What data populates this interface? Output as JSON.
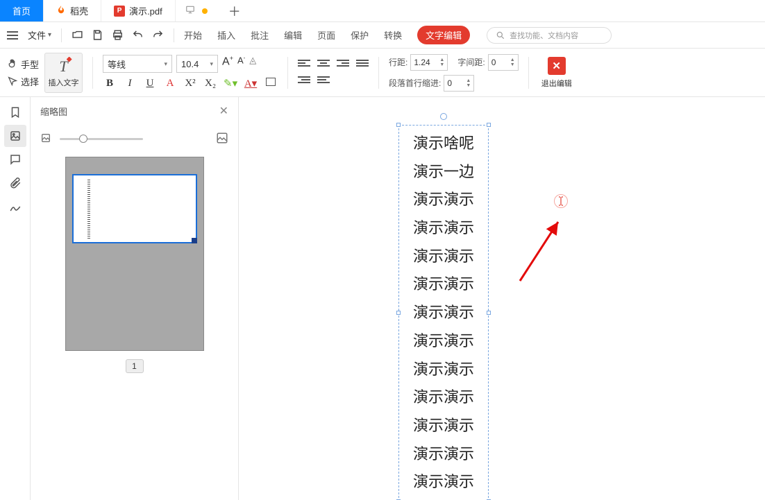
{
  "tabs": {
    "home": "首页",
    "daoshell": "稻壳",
    "doc": "演示.pdf"
  },
  "menubar": {
    "file_label": "文件",
    "start": "开始",
    "insert": "插入",
    "annotate": "批注",
    "edit": "编辑",
    "page": "页面",
    "protect": "保护",
    "convert": "转换",
    "text_edit": "文字编辑",
    "search_placeholder": "查找功能、文档内容"
  },
  "ribbon": {
    "hand": "手型",
    "select": "选择",
    "insert_text": "插入文字",
    "font_name": "等线",
    "font_size": "10.4",
    "line_spacing_label": "行距:",
    "line_spacing": "1.24",
    "char_spacing_label": "字间距:",
    "char_spacing": "0",
    "first_indent_label": "段落首行缩进:",
    "first_indent": "0",
    "exit_edit": "退出编辑"
  },
  "side_panel": {
    "title": "缩略图",
    "page_number": "1"
  },
  "document": {
    "lines": [
      "演示啥呢",
      "演示一边",
      "演示演示",
      "演示演示",
      "演示演示",
      "演示演示",
      "演示演示",
      "演示演示",
      "演示演示",
      "演示演示",
      "演示演示",
      "演示演示",
      "演示演示"
    ]
  }
}
